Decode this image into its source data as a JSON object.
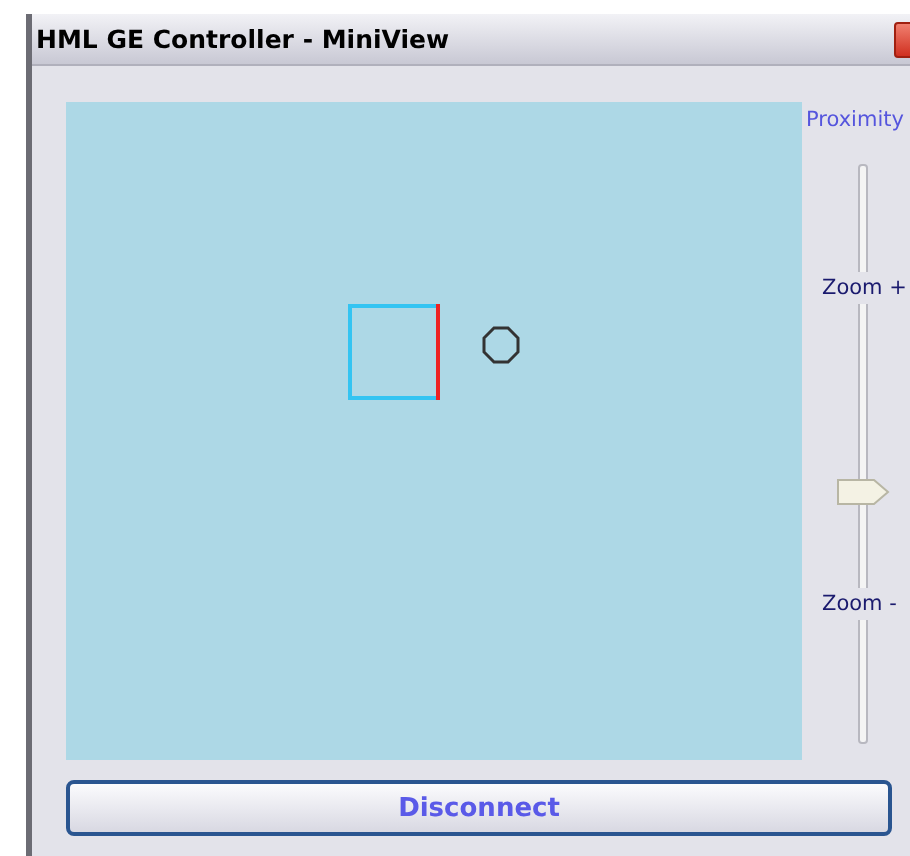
{
  "window": {
    "title": "HML GE Controller - MiniView"
  },
  "slider": {
    "title": "Proximity",
    "top_label": "Zoom +",
    "bottom_label": "Zoom -",
    "level": 0.44
  },
  "buttons": [
    {
      "label": "Disconnect"
    }
  ]
}
